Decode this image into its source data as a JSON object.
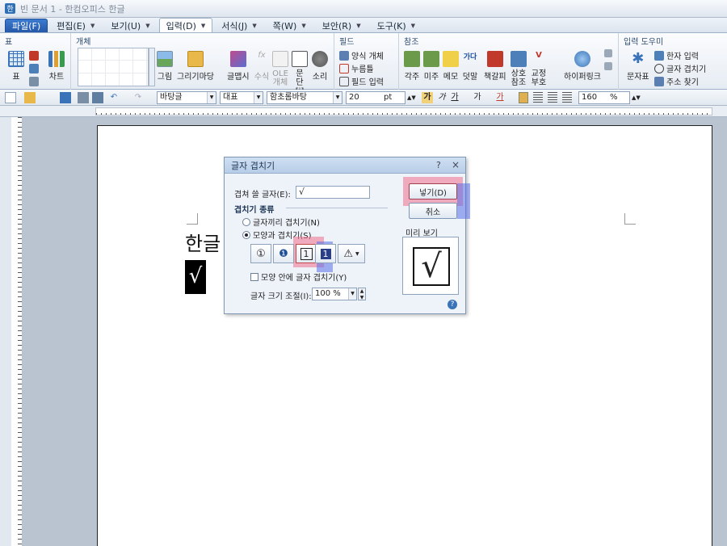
{
  "window": {
    "title": "빈 문서 1 - 한컴오피스 한글"
  },
  "menubar": {
    "items": [
      {
        "label": "파일(F)"
      },
      {
        "label": "편집(E)"
      },
      {
        "label": "보기(U)"
      },
      {
        "label": "입력(D)"
      },
      {
        "label": "서식(J)"
      },
      {
        "label": "쪽(W)"
      },
      {
        "label": "보안(R)"
      },
      {
        "label": "도구(K)"
      }
    ]
  },
  "ribbon": {
    "groups": {
      "table": "표",
      "object": "개체",
      "field": "필드",
      "reference": "참조",
      "input_helper": "입력 도우미"
    },
    "table_btn": "표",
    "chart_btn": "차트",
    "picture_btn": "그림",
    "drawing_btn": "그리기마당",
    "wordart_btn": "글맵시",
    "formula_btn": "수식",
    "ole_btn": "OLE 개체",
    "paragraph_btn": "문단 [i]",
    "sound_btn": "소리",
    "field_form": "양식 개체",
    "field_click": "누름틀",
    "field_input": "필드 입력",
    "ref_footnote": "각주",
    "ref_endnote": "미주",
    "ref_memo": "메모",
    "ref_overwrite": "덧말",
    "ref_bookmark": "책갈피",
    "ref_cross": "상호 참조",
    "ref_proof": "교정 부호",
    "hyperlink": "하이퍼링크",
    "charmap": "문자표",
    "hanja": "한자 입력",
    "overlap": "글자 겹치기",
    "addr": "주소 찾기"
  },
  "format_toolbar": {
    "style": "바탕글",
    "lang": "대표",
    "font": "함초롬바탕",
    "size": "20",
    "unit": "pt",
    "zoom": "160",
    "zoom_unit": "%"
  },
  "document": {
    "text": "한글",
    "symbol": "√"
  },
  "dialog": {
    "title": "글자 겹치기",
    "help_icon": "?",
    "close_icon": "×",
    "chars_label": "겹쳐 쓸 글자(E):",
    "chars_value": "√",
    "type_label": "겹치기 종류",
    "opt_char": "글자끼리 겹치기(N)",
    "opt_shape": "모양과 겹치기(S)",
    "shapes": [
      "①",
      "❶",
      "1",
      "1",
      "⚠"
    ],
    "inside_label": "모양 안에 글자 겹치기(Y)",
    "size_label": "글자 크기 조절(I):",
    "size_value": "100 %",
    "insert_btn": "넣기(D)",
    "cancel_btn": "취소",
    "preview_label": "미리 보기",
    "preview_symbol": "√"
  }
}
